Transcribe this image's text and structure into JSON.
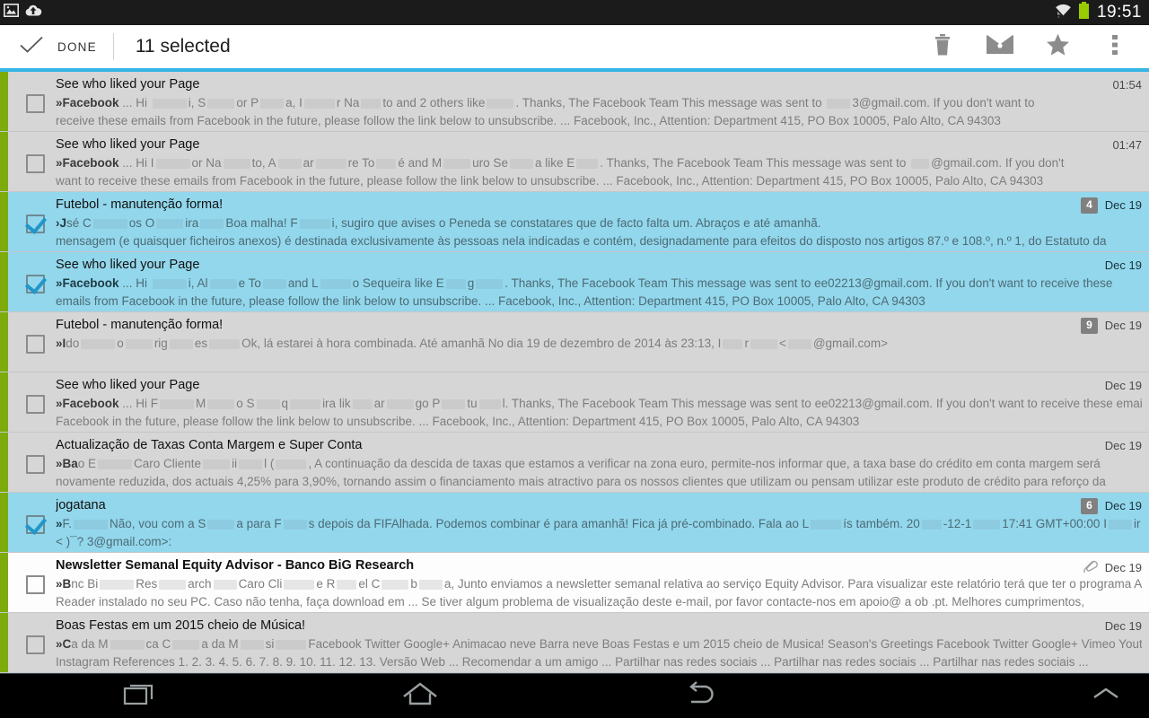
{
  "statusbar": {
    "icons": [
      "screenshot-icon",
      "cloud-upload-icon",
      "wifi-icon",
      "battery-icon"
    ],
    "time": "19:51"
  },
  "actionbar": {
    "done_label": "DONE",
    "title": "11 selected",
    "actions": [
      {
        "name": "delete-button",
        "icon": "trash-icon"
      },
      {
        "name": "mark-unread-button",
        "icon": "envelope-icon"
      },
      {
        "name": "star-button",
        "icon": "star-icon"
      },
      {
        "name": "overflow-menu-button",
        "icon": "more-vertical-icon"
      }
    ],
    "accent_color": "#33b5e5"
  },
  "colors": {
    "selected_row": "#93d7ec",
    "read_row": "#d6d6d6",
    "unread_row": "#fdfdfd",
    "label_accent": "#7cab0b",
    "badge": "#808080"
  },
  "emails": [
    {
      "subject": "See who liked your Page",
      "sender": "»Facebook",
      "snippet_a": " ... Hi ",
      "snippet_b": "i, S",
      "snippet_c": "or P",
      "snippet_d": "a, I",
      "snippet_e": "r Na",
      "snippet_f": "to and 2 others like",
      "snippet_g": ". Thanks, The Facebook Team This message was sent to ",
      "snippet_h": "3@gmail.com. If you don't want to",
      "snippet_line2": "receive these emails from Facebook in the future, please follow the link below to unsubscribe. ... Facebook, Inc., Attention: Department 415, PO Box 10005, Palo Alto, CA 94303",
      "date": "01:54",
      "count": "",
      "selected": false,
      "unread": false,
      "attachment": false
    },
    {
      "subject": "See who liked your Page",
      "sender": "»Facebook",
      "snippet_a": " ... Hi I",
      "snippet_b": "or Na",
      "snippet_c": "to, A",
      "snippet_d": "ar",
      "snippet_e": "re To",
      "snippet_f": "é and M",
      "snippet_g": "uro Se",
      "snippet_h": "a like E",
      "snippet_i": ". Thanks, The Facebook Team This message was sent to ",
      "snippet_j": "@gmail.com. If you don't",
      "snippet_line2": "want to receive these emails from Facebook in the future, please follow the link below to unsubscribe. ... Facebook, Inc., Attention: Department 415, PO Box 10005, Palo Alto, CA 94303",
      "date": "01:47",
      "count": "",
      "selected": false,
      "unread": false,
      "attachment": false
    },
    {
      "subject": "Futebol - manutenção forma!",
      "sender": "›J",
      "snippet_a": "sé C",
      "snippet_b": "os O",
      "snippet_c": "ira",
      "snippet_d": "Boa malha! F",
      "snippet_e": "i, sugiro que avises o Peneda se constatares que de facto falta um. Abraços e até amanhã.",
      "snippet_line2": "mensagem (e quaisquer ficheiros anexos) é destinada exclusivamente às pessoas nela indicadas e contém, designadamente para efeitos do disposto nos artigos 87.º e 108.º, n.º 1, do Estatuto da",
      "date": "Dec 19",
      "count": "4",
      "selected": true,
      "unread": false,
      "attachment": false
    },
    {
      "subject": "See who liked your Page",
      "sender": "»Facebook",
      "snippet_a": " ... Hi ",
      "snippet_b": "i, Al",
      "snippet_c": "e To",
      "snippet_d": "and L",
      "snippet_e": "o Sequeira like E",
      "snippet_f": "g",
      "snippet_g": ". Thanks, The Facebook Team This message was sent to ee02213@gmail.com. If you don't want to receive these",
      "snippet_line2": "emails from Facebook in the future, please follow the link below to unsubscribe. ... Facebook, Inc., Attention: Department 415, PO Box 10005, Palo Alto, CA 94303",
      "date": "Dec 19",
      "count": "",
      "selected": true,
      "unread": false,
      "attachment": false
    },
    {
      "subject": "Futebol - manutenção forma!",
      "sender": "»I",
      "snippet_a": "do",
      "snippet_b": "o",
      "snippet_c": "rig",
      "snippet_d": "es",
      "snippet_e": "Ok, lá estarei à hora combinada. Até amanhã No dia 19 de dezembro de 2014 às 23:13, I",
      "snippet_f": "r",
      "snippet_g": "<",
      "snippet_h": "@gmail.com>",
      "snippet_line2": "",
      "date": "Dec 19",
      "count": "9",
      "selected": false,
      "unread": false,
      "attachment": false
    },
    {
      "subject": "See who liked your Page",
      "sender": "»Facebook",
      "snippet_a": " ... Hi F",
      "snippet_b": "M",
      "snippet_c": "o S",
      "snippet_d": "q",
      "snippet_e": "ira lik",
      "snippet_f": "ar",
      "snippet_g": "go P",
      "snippet_h": "tu",
      "snippet_i": "l. Thanks, The Facebook Team This message was sent to ee02213@gmail.com. If you don't want to receive these emails from",
      "snippet_line2": "Facebook in the future, please follow the link below to unsubscribe. ... Facebook, Inc., Attention: Department 415, PO Box 10005, Palo Alto, CA 94303",
      "date": "Dec 19",
      "count": "",
      "selected": false,
      "unread": false,
      "attachment": false
    },
    {
      "subject": "Actualização de Taxas Conta Margem e Super Conta",
      "sender": "»Ba",
      "snippet_a": "o E",
      "snippet_b": "Caro Cliente",
      "snippet_c": "ii",
      "snippet_d": "l (",
      "snippet_e": ", A continuação da descida de taxas que estamos a verificar na zona euro, permite-nos informar que, a taxa base do crédito em conta margem será",
      "snippet_line2": "novamente reduzida, dos actuais 4,25% para 3,90%, tornando assim o financiamento mais atractivo para os nossos clientes que utilizam ou pensam utilizar este produto de crédito para reforço da",
      "date": "Dec 19",
      "count": "",
      "selected": false,
      "unread": false,
      "attachment": false
    },
    {
      "subject": "jogatana",
      "sender": "»",
      "snippet_a": "F.",
      "snippet_b": "Não, vou com a S",
      "snippet_c": "a para F",
      "snippet_d": "s depois da FIFAlhada. Podemos combinar é para amanhã! Fica já pré-combinado. Fala ao L",
      "snippet_e": "ís também. 20",
      "snippet_f": "-12-1",
      "snippet_g": "17:41 GMT+00:00 I",
      "snippet_h": "ir",
      "snippet_line2": "<    )¯? 3@gmail.com>:",
      "date": "Dec 19",
      "count": "6",
      "selected": true,
      "unread": false,
      "attachment": false
    },
    {
      "subject": "Newsletter Semanal Equity Advisor - Banco BiG Research",
      "sender": "»B",
      "snippet_a": "nc Bi",
      "snippet_b": "Res",
      "snippet_c": "arch",
      "snippet_d": "Caro Cli",
      "snippet_e": "e R",
      "snippet_f": "el C",
      "snippet_g": "b",
      "snippet_h": "a, Junto enviamos a newsletter semanal relativa ao serviço Equity Advisor. Para visualizar este relatório terá que ter o programa Acrobat",
      "snippet_line2": "Reader instalado no seu PC. Caso não tenha, faça download em ... Se tiver algum problema de visualização deste e-mail, por favor contacte-nos em apoio@   a   ob   .pt. Melhores cumprimentos,",
      "date": "Dec 19",
      "count": "",
      "selected": false,
      "unread": true,
      "attachment": true
    },
    {
      "subject": "Boas Festas em um 2015 cheio de Música!",
      "sender": "»C",
      "snippet_a": "a da M",
      "snippet_b": "ca C",
      "snippet_c": "a da M",
      "snippet_d": "si",
      "snippet_e": "Facebook Twitter Google+ Animacao neve Barra neve Boas Festas e um 2015 cheio de Musica! Season's Greetings Facebook Twitter Google+ Vimeo Youtube",
      "snippet_line2": "Instagram References 1. 2. 3. 4. 5. 6. 7. 8. 9. 10. 11. 12. 13. Versão Web ... Recomendar a um amigo ... Partilhar nas redes sociais ... Partilhar nas redes sociais ... Partilhar nas redes sociais ...",
      "date": "Dec 19",
      "count": "",
      "selected": false,
      "unread": false,
      "attachment": false
    }
  ],
  "navbar": {
    "buttons": [
      {
        "name": "recents-button",
        "icon": "recents-icon"
      },
      {
        "name": "home-button",
        "icon": "home-icon"
      },
      {
        "name": "back-button",
        "icon": "back-icon"
      },
      {
        "name": "keyboard-toggle-button",
        "icon": "chevron-up-icon"
      }
    ]
  }
}
